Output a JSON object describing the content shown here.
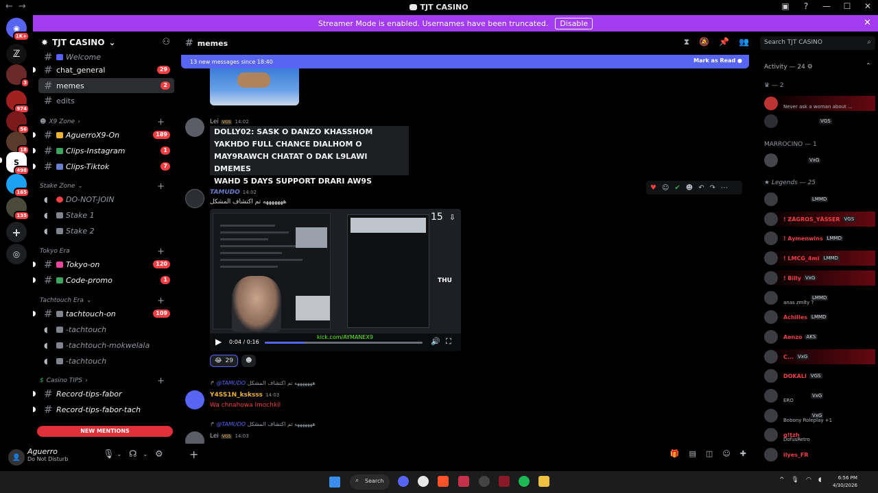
{
  "window": {
    "title": "TJT CASINO",
    "nav_back": "←",
    "nav_fwd": "→"
  },
  "banner": {
    "text": "Streamer Mode is enabled. Usernames have been truncated.",
    "disable_label": "Disable"
  },
  "rail": {
    "badges": [
      "1K+",
      "3",
      "974",
      "56",
      "18",
      "498",
      "165",
      "135"
    ]
  },
  "server": {
    "name": "TJT CASINO"
  },
  "channels": {
    "top": [
      {
        "name": "Welcome"
      },
      {
        "name": "chat_general",
        "count": "29"
      },
      {
        "name": "memes",
        "count": "2"
      },
      {
        "name": "edits"
      }
    ],
    "x9": {
      "label": "X9 Zone",
      "items": [
        {
          "name": "AguerroX9-On",
          "count": "189"
        },
        {
          "name": "Clips-Instagram",
          "count": "1"
        },
        {
          "name": "Clips-Tiktok",
          "count": "7"
        }
      ]
    },
    "stake": {
      "label": "Stake Zone",
      "items": [
        {
          "name": "DO-NOT-JOIN"
        },
        {
          "name": "Stake 1"
        },
        {
          "name": "Stake 2"
        }
      ]
    },
    "tokyo": {
      "label": "Tokyo Era",
      "items": [
        {
          "name": "Tokyo-on",
          "count": "120"
        },
        {
          "name": "Code-promo",
          "count": "1"
        }
      ]
    },
    "tachtouch": {
      "label": "Tachtouch Era",
      "items": [
        {
          "name": "tachtouch-on",
          "count": "109"
        },
        {
          "name": "-tachtouch"
        },
        {
          "name": "-tachtouch-mokwelala"
        },
        {
          "name": "-tachtouch"
        }
      ]
    },
    "casino": {
      "label": "Casino TIPS",
      "items": [
        {
          "name": "Record-tips-fabor"
        },
        {
          "name": "Record-tips-fabor-tach"
        }
      ]
    },
    "new_mentions": "NEW MENTIONS"
  },
  "user": {
    "name": "Aguerro",
    "status": "Do Not Disturb"
  },
  "chat": {
    "channel": "memes",
    "new_messages": "13 new messages since 18:40",
    "mark_read": "Mark as Read",
    "search_placeholder": "Search TJT CASINO",
    "msg1": {
      "author": "Lei",
      "tag": "VGS",
      "time": "14:02",
      "lines": [
        "DOLLY02: SASK O DANZO KHASSHOM",
        "YAKHDO FULL CHANCE DIALHOM O",
        "MAY9RAWCH CHATAT O DAK L9LAWI DMEMES",
        "WAHD 5 DAYS SUPPORT DRARI AW9S"
      ]
    },
    "msg2": {
      "author": "TAMUDO",
      "time": "14:02",
      "text": "هههههههه تم اكتشاف المشكل",
      "video": {
        "time": "0:04 / 0:16",
        "watermark": "kick.com/AYMANEX9",
        "counter": "15",
        "thu": "THU",
        "progress": 0.25
      },
      "reaction_count": "29"
    },
    "msg3": {
      "reply_to": "@TAMUDO",
      "reply_text": "هههههههه تم اكتشاف المشكل",
      "author": "Y4SS1N_ksksss",
      "time": "14:03",
      "text": "Wa chnahowa lmochkil"
    },
    "msg4": {
      "reply_to": "@TAMUDO",
      "reply_text": "هههههههه تم اكتشاف المشكل",
      "author": "Lei",
      "tag": "VGS",
      "time": "14:03"
    }
  },
  "members": {
    "activity": "Activity — 24",
    "groups": {
      "g1": "— 2",
      "marrocino": "MARROCINO — 1",
      "legends": "Legends — 25"
    },
    "activity_items": [
      {
        "sub": "Never ask a woman about ..."
      },
      {
        "tag": "VGS"
      }
    ],
    "marrocino_items": [
      {
        "tag": "VxG"
      }
    ],
    "legend_items": [
      {
        "name": "",
        "tag": "LMMD",
        "color": "#c7c9cc"
      },
      {
        "name": "! ƵÄGROS_YÅSSER",
        "tag": "VGS",
        "color": "#f23f43"
      },
      {
        "name": "! Aymenwins",
        "tag": "LMMD",
        "color": "#f23f43"
      },
      {
        "name": "! LMCG_4mi",
        "tag": "LMMD",
        "color": "#f23f43"
      },
      {
        "name": "! Billy",
        "tag": "VxG",
        "color": "#f23f43"
      },
      {
        "name": "",
        "tag": "LMMD",
        "color": "#c7c9cc",
        "sub": "anas zmlty ?"
      },
      {
        "name": "Achilles",
        "tag": "LMMD",
        "color": "#f23f43"
      },
      {
        "name": "Aenzo",
        "tag": "AKS",
        "color": "#f23f43"
      },
      {
        "name": "C...",
        "tag": "VxG",
        "color": "#f23f43"
      },
      {
        "name": "DOKALI",
        "tag": "VGS",
        "color": "#f23f43"
      },
      {
        "name": "",
        "tag": "VxG",
        "color": "#c7c9cc",
        "sub": "ERO"
      },
      {
        "name": "",
        "tag": "VxG",
        "color": "#c7c9cc",
        "sub": "Bobony Roleplay +1"
      },
      {
        "name": "g!tzh",
        "tag": "",
        "color": "#f23f43",
        "sub": "DofusRetro"
      },
      {
        "name": "ilyes_FR",
        "tag": "",
        "color": "#f23f43"
      }
    ]
  },
  "taskbar": {
    "search": "Search",
    "time": "6:56 PM",
    "date": "4/30/2026"
  },
  "colors": {
    "accent": "#5865f2",
    "banner": "#a33cf0",
    "danger": "#f23f43"
  }
}
